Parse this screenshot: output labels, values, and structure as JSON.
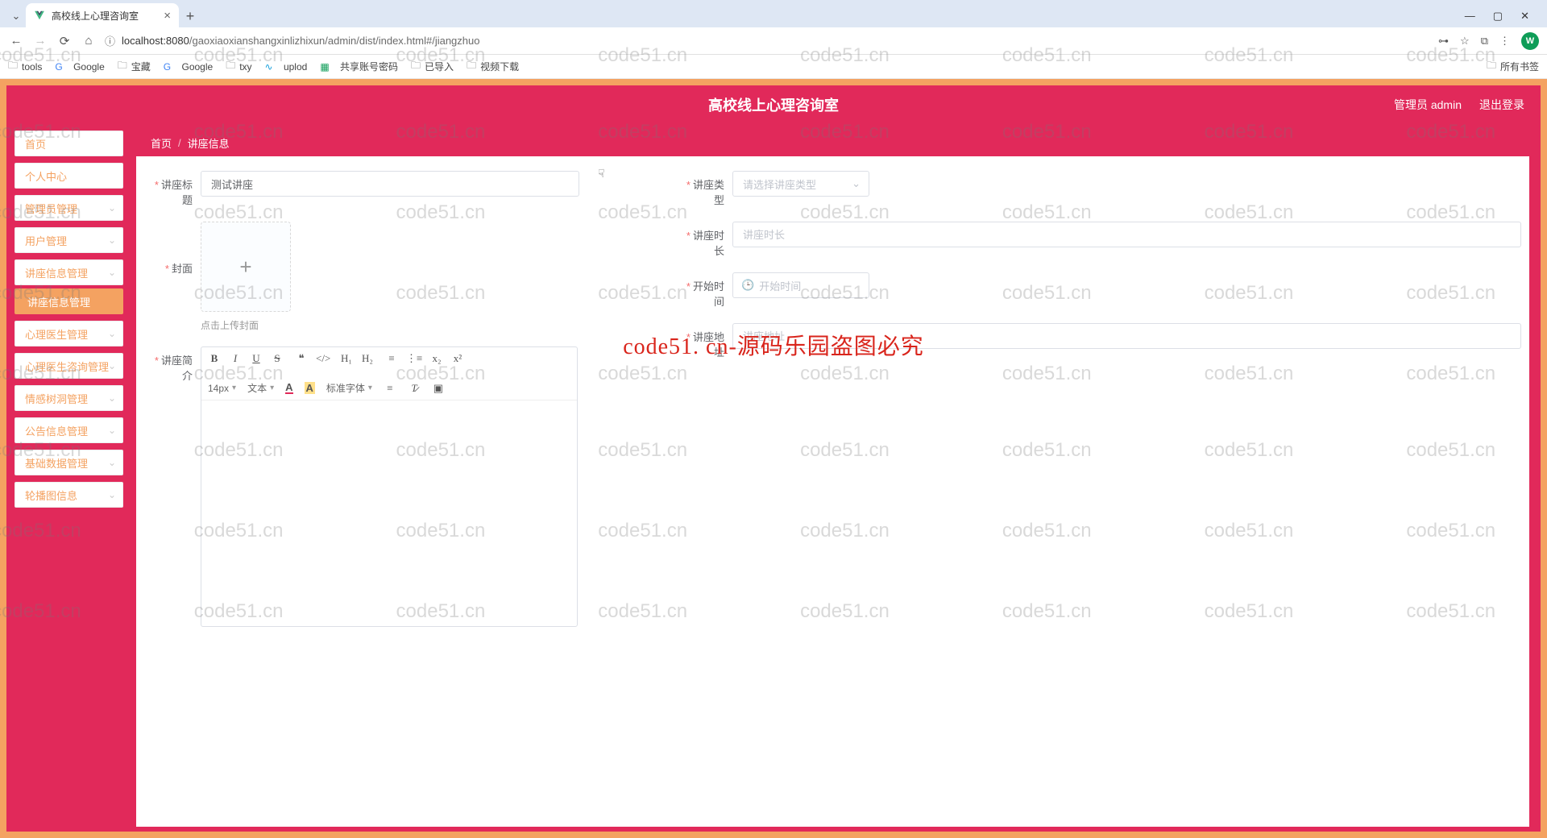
{
  "browser": {
    "tab_title": "高校线上心理咨询室",
    "url_host": "localhost:8080",
    "url_path": "/gaoxiaoxianshangxinlizhixun/admin/dist/index.html#/jiangzhuo",
    "avatar_letter": "W",
    "bookmarks": [
      "tools",
      "Google",
      "宝藏",
      "Google",
      "txy",
      "uplod",
      "共享账号密码",
      "已导入",
      "视频下载"
    ],
    "bookmarks_right": "所有书签"
  },
  "app": {
    "title": "高校线上心理咨询室",
    "user_label": "管理员 admin",
    "logout": "退出登录"
  },
  "sidebar": {
    "items": [
      {
        "label": "首页",
        "expandable": false
      },
      {
        "label": "个人中心",
        "expandable": false
      },
      {
        "label": "管理员管理",
        "expandable": true
      },
      {
        "label": "用户管理",
        "expandable": true
      },
      {
        "label": "讲座信息管理",
        "expandable": true,
        "open": true,
        "sub": "讲座信息管理"
      },
      {
        "label": "心理医生管理",
        "expandable": true
      },
      {
        "label": "心理医生咨询管理",
        "expandable": true
      },
      {
        "label": "情感树洞管理",
        "expandable": true
      },
      {
        "label": "公告信息管理",
        "expandable": true
      },
      {
        "label": "基础数据管理",
        "expandable": true
      },
      {
        "label": "轮播图信息",
        "expandable": true
      }
    ]
  },
  "breadcrumb": {
    "home": "首页",
    "current": "讲座信息"
  },
  "form": {
    "title_label": "讲座标题",
    "title_value": "测试讲座",
    "cover_label": "封面",
    "cover_hint": "点击上传封面",
    "intro_label": "讲座简介",
    "type_label": "讲座类型",
    "type_placeholder": "请选择讲座类型",
    "duration_label": "讲座时长",
    "duration_placeholder": "讲座时长",
    "start_label": "开始时间",
    "start_placeholder": "开始时间",
    "addr_label": "讲座地址",
    "addr_placeholder": "讲座地址"
  },
  "editor": {
    "font_size": "14px",
    "text_menu": "文本",
    "font_family": "标准字体"
  },
  "watermark": {
    "text": "code51.cn",
    "center": "code51. cn-源码乐园盗图必究"
  }
}
